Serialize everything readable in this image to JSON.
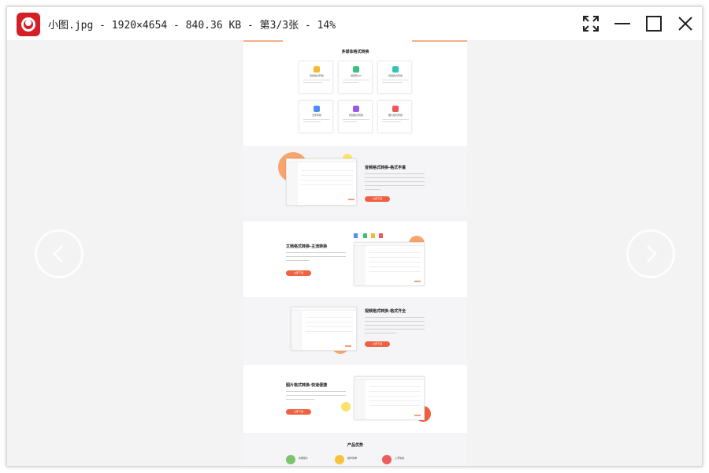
{
  "window": {
    "title": "小图.jpg - 1920×4654 - 840.36 KB - 第3/3张 - 14%"
  },
  "titlebar_icons": {
    "logo": "photo-viewer-logo-icon",
    "fullscreen": "fullscreen-icon",
    "minimize": "minimize-icon",
    "maximize": "maximize-icon",
    "close": "close-icon"
  },
  "nav": {
    "prev": "chevron-left-icon",
    "next": "chevron-right-icon"
  },
  "image": {
    "section_title": "多媒体格式转换",
    "cards": [
      {
        "label": "音频格式转换",
        "color": "#f5b92e"
      },
      {
        "label": "视频转GIF",
        "color": "#3ac27c"
      },
      {
        "label": "视频格式转换",
        "color": "#2fc6b4"
      },
      {
        "label": "文件转换",
        "color": "#4f8ef0"
      },
      {
        "label": "视频格式转换",
        "color": "#9b59e8"
      },
      {
        "label": "图片格式转换",
        "color": "#f0575b"
      }
    ],
    "features": [
      {
        "title": "音频格式转换-格式丰富",
        "button": "立即下载"
      },
      {
        "title": "文档格式转换-主流转换",
        "button": "立即下载"
      },
      {
        "title": "视频格式转换-格式齐全",
        "button": "立即下载"
      },
      {
        "title": "图片格式转换-快速便捷",
        "button": "立即下载"
      }
    ],
    "advantages_title": "产品优势",
    "advantages": [
      {
        "label": "功能强大",
        "color": "#7cc46b"
      },
      {
        "label": "操作简单",
        "color": "#f6c23c"
      },
      {
        "label": "上手快速",
        "color": "#ef5a5a"
      }
    ],
    "colors": {
      "accent": "#ef6141",
      "orange_circle": "#f8a46c",
      "yellow_circle": "#f9e36b"
    }
  }
}
